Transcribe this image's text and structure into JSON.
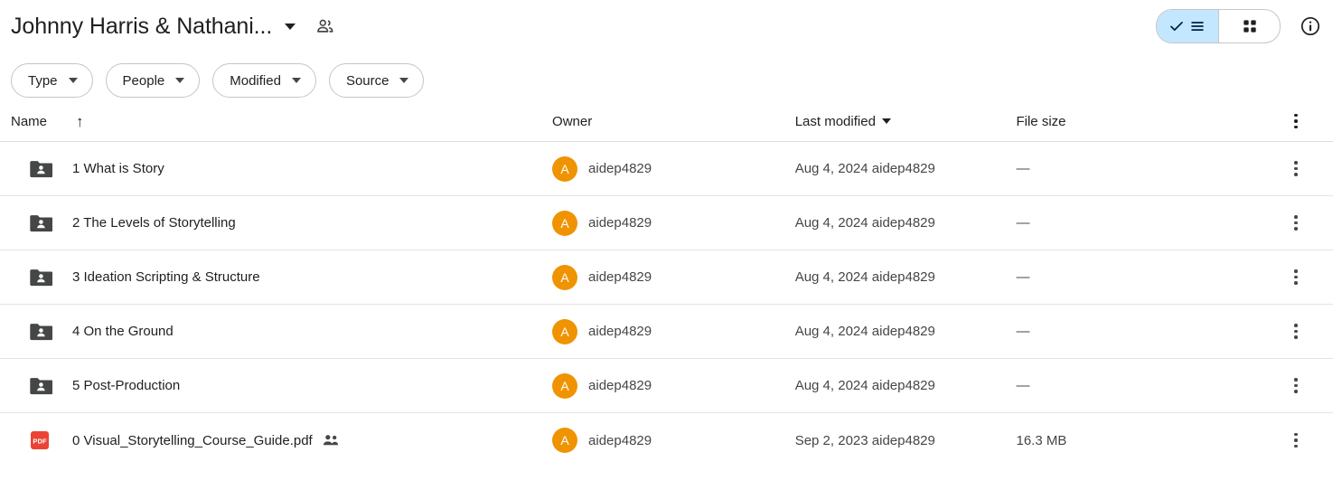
{
  "header": {
    "title": "Johnny Harris & Nathani...",
    "title_dropdown_icon": "chevron-down-icon",
    "shared_icon": "people-shared-icon",
    "view_toggle": {
      "list": {
        "icon": "check-list-view-icon",
        "label": "List view",
        "selected": true
      },
      "grid": {
        "icon": "grid-view-icon",
        "label": "Grid view",
        "selected": false
      }
    },
    "info_icon": "info-circle-icon"
  },
  "filters": [
    {
      "label": "Type",
      "icon": "chevron-down-icon"
    },
    {
      "label": "People",
      "icon": "chevron-down-icon"
    },
    {
      "label": "Modified",
      "icon": "chevron-down-icon"
    },
    {
      "label": "Source",
      "icon": "chevron-down-icon"
    }
  ],
  "columns": {
    "name": "Name",
    "name_sort_icon": "arrow-up-icon",
    "owner": "Owner",
    "last_modified": "Last modified",
    "last_modified_sort_icon": "chevron-down-icon",
    "file_size": "File size",
    "menu_icon": "more-vertical-icon"
  },
  "colors": {
    "accent_selected": "#c2e7ff",
    "avatar": "#f09300",
    "pdf": "#ea4335",
    "folder": "#5f6368",
    "divider": "#e3e3e3",
    "text_primary": "#1f1f1f",
    "text_secondary": "#444746"
  },
  "rows": [
    {
      "icon": "shared-folder-icon",
      "name": "1 What is Story",
      "shared_badge": false,
      "owner_initial": "A",
      "owner": "aidep4829",
      "modified": "Aug 4, 2024 aidep4829",
      "size": "—"
    },
    {
      "icon": "shared-folder-icon",
      "name": "2 The Levels of Storytelling",
      "shared_badge": false,
      "owner_initial": "A",
      "owner": "aidep4829",
      "modified": "Aug 4, 2024 aidep4829",
      "size": "—"
    },
    {
      "icon": "shared-folder-icon",
      "name": "3 Ideation Scripting & Structure",
      "shared_badge": false,
      "owner_initial": "A",
      "owner": "aidep4829",
      "modified": "Aug 4, 2024 aidep4829",
      "size": "—"
    },
    {
      "icon": "shared-folder-icon",
      "name": "4 On the Ground",
      "shared_badge": false,
      "owner_initial": "A",
      "owner": "aidep4829",
      "modified": "Aug 4, 2024 aidep4829",
      "size": "—"
    },
    {
      "icon": "shared-folder-icon",
      "name": "5 Post-Production",
      "shared_badge": false,
      "owner_initial": "A",
      "owner": "aidep4829",
      "modified": "Aug 4, 2024 aidep4829",
      "size": "—"
    },
    {
      "icon": "pdf-file-icon",
      "name": "0 Visual_Storytelling_Course_Guide.pdf",
      "shared_badge": true,
      "owner_initial": "A",
      "owner": "aidep4829",
      "modified": "Sep 2, 2023 aidep4829",
      "size": "16.3 MB"
    }
  ]
}
